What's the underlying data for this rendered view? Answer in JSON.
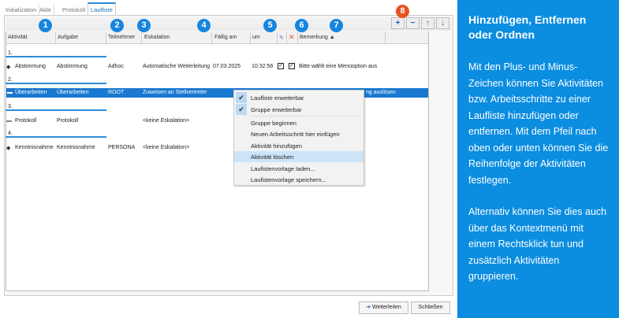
{
  "tabs": [
    "Initialization",
    "Akte",
    "Protokoll",
    "Laufliste"
  ],
  "toolbar": {
    "add": "+",
    "remove": "−",
    "up": "↑",
    "down": "↓"
  },
  "columns": [
    "Aktivität",
    "Aufgabe",
    "Teilnehmer",
    "Eskalation",
    "Fällig am",
    "um",
    "Bemerkung"
  ],
  "sort_indicator": "▲",
  "badges": [
    "1",
    "2",
    "3",
    "4",
    "5",
    "6",
    "7",
    "8"
  ],
  "groups": [
    "1.",
    "2.",
    "3.",
    "4."
  ],
  "rows": [
    {
      "aktivitaet": "Abstimmung",
      "aufgabe": "Abstimmung",
      "teilnehmer": "Adhoc",
      "eskalation": "Automatische Weiterleitung",
      "faellig": "07.03.2025",
      "um": "10:32:56",
      "bemerkung": "Bitte wählt eine Menüoption aus"
    },
    {
      "aktivitaet": "Überarbeiten",
      "aufgabe": "Überarbeiten",
      "teilnehmer": "ROOT",
      "eskalation": "Zuweisen an Stellvertreter",
      "bemerkung": "ng auslösen"
    },
    {
      "aktivitaet": "Protokoll",
      "aufgabe": "Protokoll",
      "eskalation": "<keine Eskalation>"
    },
    {
      "aktivitaet": "Kenntnisnahme",
      "aufgabe": "Kenntnisnahme",
      "teilnehmer": "PERSONA",
      "eskalation": "<keine Eskalation>"
    }
  ],
  "menu": [
    "Laufliste erweiterbar",
    "Gruppe erweiterbar",
    "Gruppe beginnen",
    "Neuen Arbeitsschritt hier einfügen",
    "Aktivität hinzufügen",
    "Aktivität löschen",
    "Laufistenvorlage laden...",
    "Laufistenvorlage speichern..."
  ],
  "buttons": {
    "forward": "Weiterleiten",
    "close": "Schließen"
  },
  "panel": {
    "title": "Hinzufügen, Entfernen oder Ordnen",
    "p1": "Mit den Plus- und Minus-Zeichen können Sie Aktivitäten bzw. Arbeitsschritte zu einer Laufliste hinzufügen oder entfernen. Mit dem Pfeil nach oben oder unten können Sie die Reihenfolge der Aktivitäten festlegen.",
    "p2": "Alternativ können Sie dies auch über das Kontextmenü mit einem Rechtsklick tun und zusätzlich Aktivitäten gruppieren."
  },
  "colors": {
    "accent": "#0b8de0",
    "badge8": "#e8511e"
  }
}
